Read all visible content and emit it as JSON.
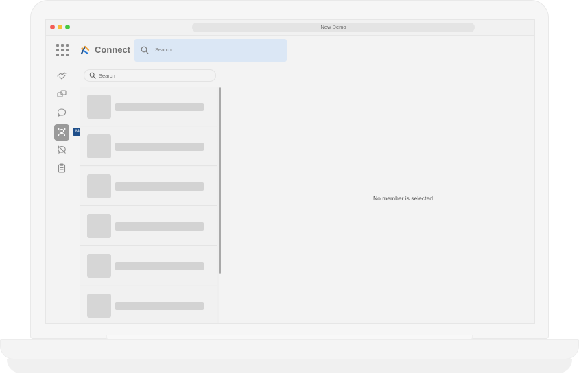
{
  "window": {
    "title": "New Demo"
  },
  "app": {
    "name": "Connect",
    "search_placeholder": "Search",
    "logo_icon": "connect-logo-icon",
    "accent_color": "#1f4f8a"
  },
  "sidebar": {
    "items": [
      {
        "icon": "handshake-icon"
      },
      {
        "icon": "swap-icon"
      },
      {
        "icon": "chat-icon"
      },
      {
        "icon": "members-icon",
        "active": true,
        "tooltip": "Members"
      },
      {
        "icon": "hidden-chat-icon"
      },
      {
        "icon": "clipboard-icon"
      }
    ]
  },
  "member_list": {
    "search_placeholder": "Search",
    "placeholder_rows": 6
  },
  "detail": {
    "empty_message": "No member is selected"
  }
}
